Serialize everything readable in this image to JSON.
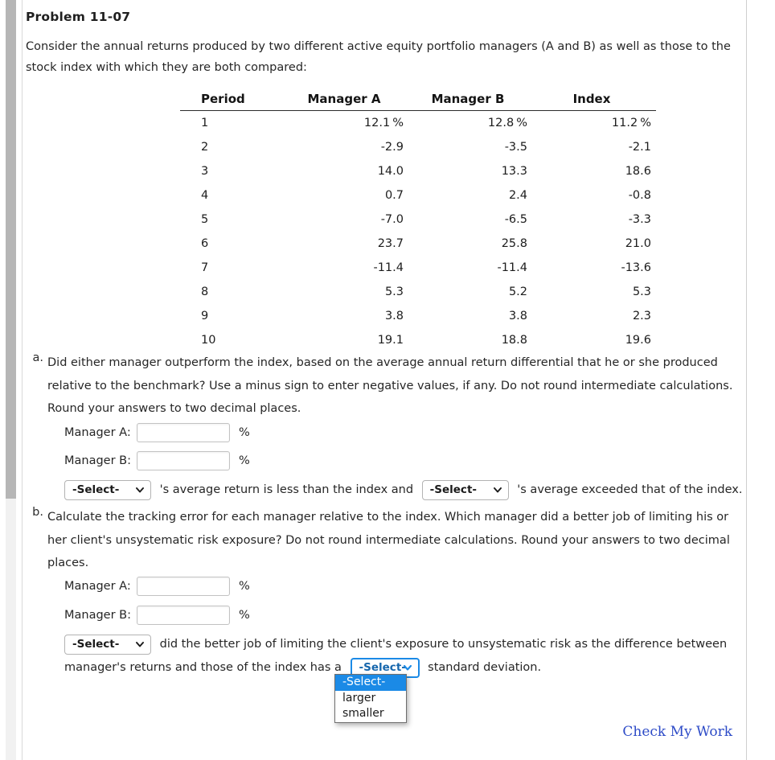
{
  "problem": {
    "title": "Problem 11-07",
    "intro": "Consider the annual returns produced by two different active equity portfolio managers (A and B) as well as those to the stock index with which they are both compared:"
  },
  "table": {
    "headers": [
      "Period",
      "Manager A",
      "Manager B",
      "Index"
    ],
    "percent_symbol": "%",
    "rows": [
      {
        "period": "1",
        "manager_a": "12.1",
        "manager_b": "12.8",
        "index": "11.2",
        "show_pct": true
      },
      {
        "period": "2",
        "manager_a": "-2.9",
        "manager_b": "-3.5",
        "index": "-2.1",
        "show_pct": false
      },
      {
        "period": "3",
        "manager_a": "14.0",
        "manager_b": "13.3",
        "index": "18.6",
        "show_pct": false
      },
      {
        "period": "4",
        "manager_a": "0.7",
        "manager_b": "2.4",
        "index": "-0.8",
        "show_pct": false
      },
      {
        "period": "5",
        "manager_a": "-7.0",
        "manager_b": "-6.5",
        "index": "-3.3",
        "show_pct": false
      },
      {
        "period": "6",
        "manager_a": "23.7",
        "manager_b": "25.8",
        "index": "21.0",
        "show_pct": false
      },
      {
        "period": "7",
        "manager_a": "-11.4",
        "manager_b": "-11.4",
        "index": "-13.6",
        "show_pct": false
      },
      {
        "period": "8",
        "manager_a": "5.3",
        "manager_b": "5.2",
        "index": "5.3",
        "show_pct": false
      },
      {
        "period": "9",
        "manager_a": "3.8",
        "manager_b": "3.8",
        "index": "2.3",
        "show_pct": false
      },
      {
        "period": "10",
        "manager_a": "19.1",
        "manager_b": "18.8",
        "index": "19.6",
        "show_pct": false
      }
    ]
  },
  "part_a": {
    "label": "a.",
    "text": "Did either manager outperform the index, based on the average annual return differential that he or she produced relative to the benchmark? Use a minus sign to enter negative values, if any. Do not round intermediate calculations. Round your answers to two decimal places.",
    "manager_a_label": "Manager A:",
    "manager_a_value": "",
    "manager_b_label": "Manager B:",
    "manager_b_value": "",
    "unit": "%",
    "select1_value": "-Select-",
    "statement_mid": "'s average return is less than the index and",
    "select2_value": "-Select-",
    "statement_end": "'s average exceeded that of the index."
  },
  "part_b": {
    "label": "b.",
    "text": "Calculate the tracking error for each manager relative to the index. Which manager did a better job of limiting his or her client's unsystematic risk exposure? Do not round intermediate calculations. Round your answers to two decimal places.",
    "manager_a_label": "Manager A:",
    "manager_a_value": "",
    "manager_b_label": "Manager B:",
    "manager_b_value": "",
    "unit": "%",
    "select1_value": "-Select-",
    "statement_line1": "did the better job of limiting the client's exposure to unsystematic risk as the difference between",
    "statement_line2_pre": "manager's returns and those of the index has a",
    "select2_value": "-Select-",
    "statement_line2_post": "standard deviation."
  },
  "dropdown": {
    "open": true,
    "options": [
      "-Select-",
      "larger",
      "smaller"
    ],
    "selected_index": 0,
    "highlight_color": "#1b8ae6"
  },
  "footer": {
    "check_my_work": "Check My Work",
    "link_color": "#2d4bc7"
  }
}
